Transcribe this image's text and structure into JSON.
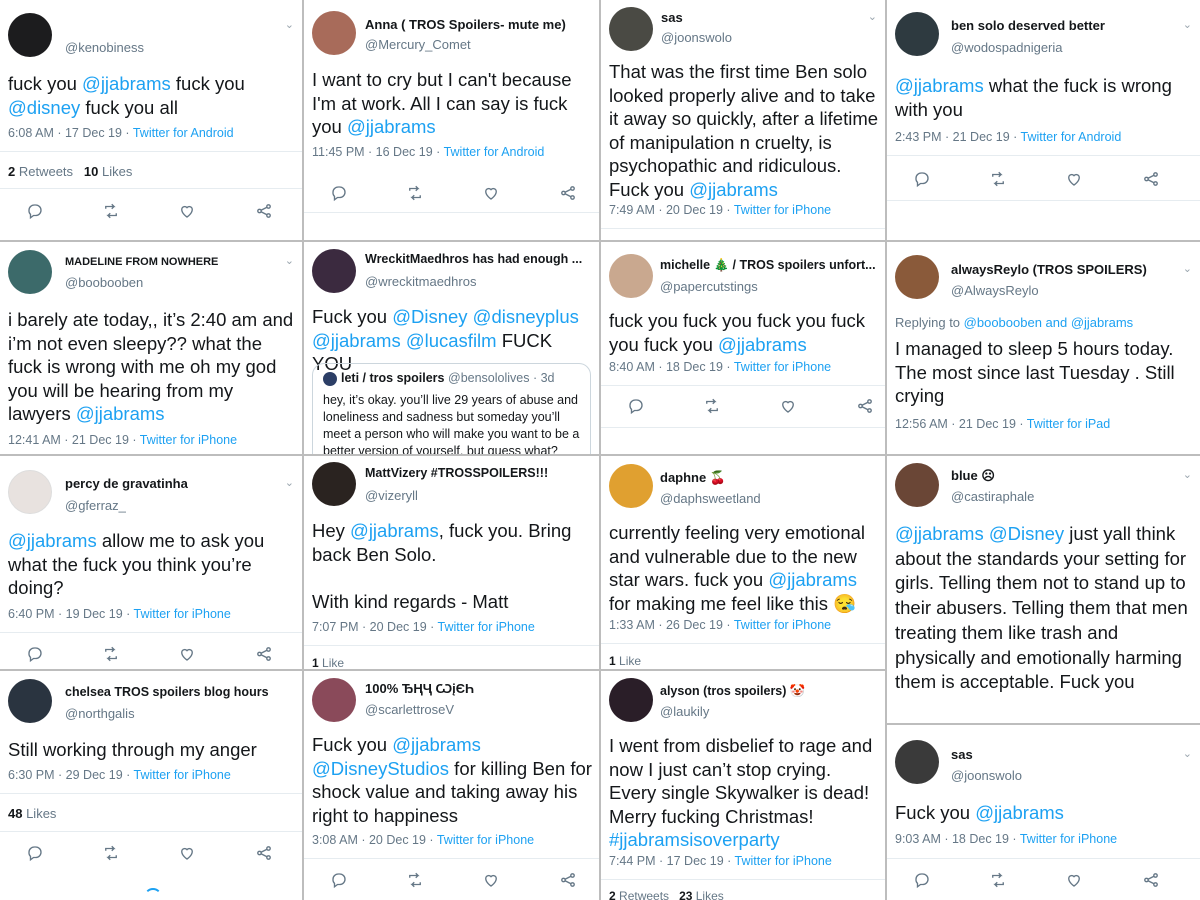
{
  "colors": {
    "accent": "#1da1f2",
    "muted": "#657786",
    "text": "#14171a",
    "divider": "#e6ecf0",
    "grid": "#bdbdbd"
  },
  "icons": [
    "reply-icon",
    "retweet-icon",
    "like-icon",
    "share-icon",
    "chevron-down-icon"
  ],
  "tweets": [
    {
      "name": "",
      "handle": "@kenobiness",
      "avatar": "#1c1c1e",
      "body": [
        {
          "t": "fuck you "
        },
        {
          "t": "@jjabrams",
          "m": 1
        },
        {
          "t": " fuck you "
        },
        {
          "t": "@disney",
          "m": 1
        },
        {
          "t": " fuck you all"
        }
      ],
      "time": "6:08 AM · 17 Dec 19 · ",
      "source": "Twitter for Android",
      "stats": [
        {
          "n": "2",
          "l": " Retweets"
        },
        {
          "n": "10",
          "l": " Likes"
        }
      ]
    },
    {
      "name": "Anna ( TROS Spoilers- mute me)",
      "handle": "@Mercury_Comet",
      "avatar": "#a86b5a",
      "body": [
        {
          "t": "I want to cry but I can't because I'm at work. All I can say is  fuck you "
        },
        {
          "t": "@jjabrams",
          "m": 1
        }
      ],
      "time": "11:45 PM · 16 Dec 19 · ",
      "source": "Twitter for Android"
    },
    {
      "name": "sas",
      "handle": "@joonswolo",
      "avatar": "#4a4a44",
      "body": [
        {
          "t": "That was the first time Ben solo looked properly alive and to take it away so quickly, after a lifetime of manipulation n cruelty, is psychopathic and ridiculous. Fuck you "
        },
        {
          "t": "@jjabrams",
          "m": 1
        }
      ],
      "time": "7:49 AM · 20 Dec 19 · ",
      "source": "Twitter for iPhone"
    },
    {
      "name": "ben solo deserved better",
      "handle": "@wodospadnigeria",
      "avatar": "#2e3a40",
      "body": [
        {
          "t": "@jjabrams",
          "m": 1
        },
        {
          "t": " what the fuck is wrong with you"
        }
      ],
      "time": "2:43 PM · 21 Dec 19 · ",
      "source": "Twitter for Android"
    },
    {
      "name": "MADELINE FROM NOWHERE",
      "handle": "@boobooben",
      "avatar": "#3c6a6a",
      "body": [
        {
          "t": "i barely ate today,, it’s 2:40 am and i’m not even sleepy?? what the fuck is wrong with me oh my god you will be hearing from my lawyers "
        },
        {
          "t": "@jjabrams",
          "m": 1
        }
      ],
      "time": "12:41 AM · 21 Dec 19 · ",
      "source": "Twitter for iPhone"
    },
    {
      "name": "WreckitMaedhros has had enough ...",
      "handle": "@wreckitmaedhros",
      "avatar": "#3b2a3f",
      "body": [
        {
          "t": "Fuck you "
        },
        {
          "t": "@Disney",
          "m": 1
        },
        {
          "t": " "
        },
        {
          "t": "@disneyplus",
          "m": 1
        },
        {
          "t": " "
        },
        {
          "t": "@jjabrams",
          "m": 1
        },
        {
          "t": " "
        },
        {
          "t": "@lucasfilm",
          "m": 1
        },
        {
          "t": " FUCK YOU"
        }
      ],
      "quote": {
        "name": "leti / tros spoilers",
        "handle": "@bensololives · 3d",
        "body": "hey, it’s okay. you’ll live 29 years of abuse and loneliness and sadness but someday you’ll meet a person who will make you want to be a better version of yourself, but guess what?"
      }
    },
    {
      "name": "michelle 🎄 / TROS spoilers unfort...",
      "handle": "@papercutstings",
      "avatar": "#c9a88f",
      "body": [
        {
          "t": "fuck you fuck you fuck you fuck you fuck you "
        },
        {
          "t": "@jjabrams",
          "m": 1
        }
      ],
      "time": "8:40 AM · 18 Dec 19 · ",
      "source": "Twitter for iPhone"
    },
    {
      "name": "alwaysReylo (TROS SPOILERS)",
      "handle": "@AlwaysReylo",
      "avatar": "#8a5a3a",
      "reply": "Replying to ",
      "reply_to": "@boobooben and @jjabrams",
      "body": [
        {
          "t": "I managed to sleep 5 hours today. The most since last Tuesday . Still crying"
        }
      ],
      "time": "12:56 AM · 21 Dec 19 · ",
      "source": "Twitter for iPad"
    },
    {
      "name": "percy de gravatinha",
      "handle": "@gferraz_",
      "avatar": "#e8e2df",
      "body": [
        {
          "t": "@jjabrams",
          "m": 1
        },
        {
          "t": " allow me to ask you what the fuck you think you’re doing?"
        }
      ],
      "time": "6:40 PM · 19 Dec 19 · ",
      "source": "Twitter for iPhone"
    },
    {
      "name": "MattVizery #TROSSPOILERS!!!",
      "handle": "@vizeryll",
      "avatar": "#2a2320",
      "body": [
        {
          "t": "Hey "
        },
        {
          "t": "@jjabrams",
          "m": 1
        },
        {
          "t": ", fuck you. Bring back Ben Solo.\n\nWith kind regards - Matt"
        }
      ],
      "time": "7:07 PM · 20 Dec 19 · ",
      "source": "Twitter for iPhone",
      "stats": [
        {
          "n": "1",
          "l": " Like"
        }
      ]
    },
    {
      "name": "daphne 🍒",
      "handle": "@daphsweetland",
      "avatar": "#e0a030",
      "body": [
        {
          "t": "currently feeling very emotional and vulnerable due to the new star wars. fuck you "
        },
        {
          "t": "@jjabrams",
          "m": 1
        },
        {
          "t": " for making me feel like this 😪"
        }
      ],
      "time": "1:33 AM · 26 Dec 19 · ",
      "source": "Twitter for iPhone",
      "stats": [
        {
          "n": "1",
          "l": " Like"
        }
      ]
    },
    {
      "name": "blue ☹",
      "handle": "@castiraphale",
      "avatar": "#6a4636",
      "body": [
        {
          "t": "@jjabrams",
          "m": 1
        },
        {
          "t": " "
        },
        {
          "t": "@Disney",
          "m": 1
        },
        {
          "t": " just yall think about the standards your setting for girls. Telling them not to stand up to their abusers. Telling them that men treating them like trash and physically and emotionally harming them is acceptable. Fuck you"
        }
      ]
    },
    {
      "name": "chelsea TROS spoilers blog hours",
      "handle": "@northgalis",
      "avatar": "#2a3440",
      "body": [
        {
          "t": "Still working through my anger"
        }
      ],
      "time": "6:30 PM · 29 Dec 19 · ",
      "source": "Twitter for iPhone",
      "stats": [
        {
          "n": "48",
          "l": " Likes"
        }
      ]
    },
    {
      "name": "100% ЂҢҶ ѠįЄҺ",
      "handle": "@scarlettroseV",
      "avatar": "#8a4a5a",
      "body": [
        {
          "t": "Fuck you "
        },
        {
          "t": "@jjabrams",
          "m": 1
        },
        {
          "t": " "
        },
        {
          "t": "@DisneyStudios",
          "m": 1
        },
        {
          "t": " for killing Ben for shock value and taking away his right to happiness"
        }
      ],
      "time": "3:08 AM · 20 Dec 19 · ",
      "source": "Twitter for iPhone"
    },
    {
      "name": "alyson (tros spoilers) 🤡",
      "handle": "@laukily",
      "avatar": "#2a1e28",
      "body": [
        {
          "t": "I went from disbelief to rage and now I just can’t stop crying. Every single Skywalker is dead! Merry fucking Christmas! "
        },
        {
          "t": "#jjabramsisoverparty",
          "m": 1
        }
      ],
      "time": "7:44 PM · 17 Dec 19 · ",
      "source": "Twitter for iPhone",
      "stats": [
        {
          "n": "2",
          "l": " Retweets"
        },
        {
          "n": "23",
          "l": " Likes"
        }
      ]
    },
    {
      "name": "sas",
      "handle": "@joonswolo",
      "avatar": "#3a3a3a",
      "body": [
        {
          "t": "Fuck you "
        },
        {
          "t": "@jjabrams",
          "m": 1
        }
      ],
      "time": "9:03 AM · 18 Dec 19 · ",
      "source": "Twitter for iPhone"
    }
  ]
}
